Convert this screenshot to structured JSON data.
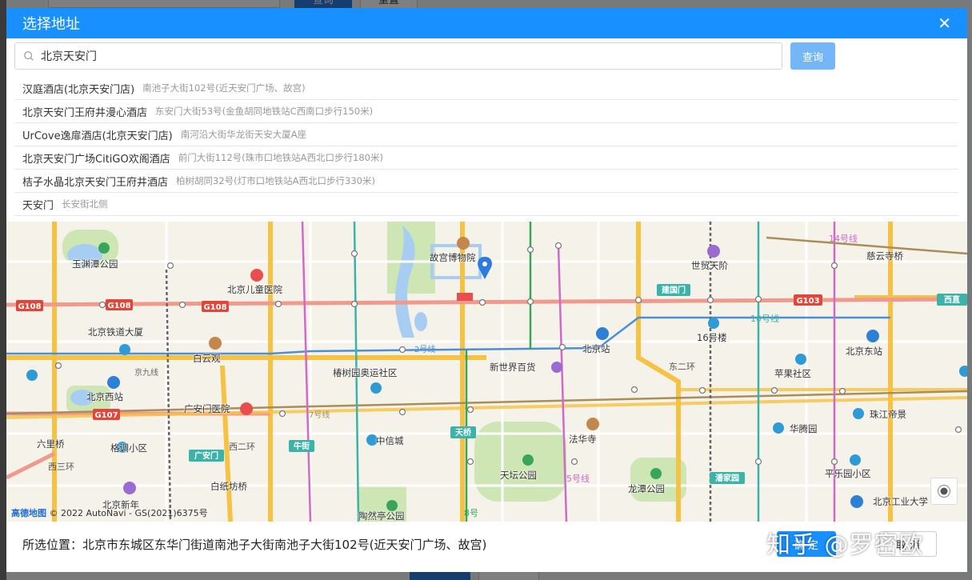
{
  "background": {
    "top_query_label": "查询",
    "top_reset_label": "重置"
  },
  "dialog": {
    "title": "选择地址",
    "close_icon": "close-icon"
  },
  "search": {
    "value": "北京天安门",
    "icon": "search-icon",
    "query_label": "查询"
  },
  "results": [
    {
      "name": "汉庭酒店(北京天安门店)",
      "address": "南池子大街102号(近天安门广场、故宫)"
    },
    {
      "name": "北京天安门王府井漫心酒店",
      "address": "东安门大街53号(金鱼胡同地铁站C西南口步行150米)"
    },
    {
      "name": "UrCove逸扉酒店(北京天安门店)",
      "address": "南河沿大街华龙街天安大厦A座"
    },
    {
      "name": "北京天安门广场CitiGO欢阁酒店",
      "address": "前门大街112号(珠市口地铁站A西北口步行180米)"
    },
    {
      "name": "桔子水晶北京天安门王府井酒店",
      "address": "柏树胡同32号(灯市口地铁站A西北口步行330米)"
    },
    {
      "name": "天安门",
      "address": "长安街北侧"
    }
  ],
  "map": {
    "labels": [
      {
        "text": "故宫博物院"
      },
      {
        "text": "玉渊潭公园"
      },
      {
        "text": "北京儿童医院"
      },
      {
        "text": "世贸天阶"
      },
      {
        "text": "慈云寺桥"
      },
      {
        "text": "建国门"
      },
      {
        "text": "北京铁道大厦"
      },
      {
        "text": "白云观"
      },
      {
        "text": "16号楼"
      },
      {
        "text": "北京站"
      },
      {
        "text": "北京东站"
      },
      {
        "text": "新世界百货"
      },
      {
        "text": "椿树园奥运社区"
      },
      {
        "text": "苹果社区"
      },
      {
        "text": "北京西站"
      },
      {
        "text": "广安门医院"
      },
      {
        "text": "华腾园"
      },
      {
        "text": "珠江帝景"
      },
      {
        "text": "法华寺"
      },
      {
        "text": "天桥"
      },
      {
        "text": "六里桥"
      },
      {
        "text": "格调小区"
      },
      {
        "text": "中信城"
      },
      {
        "text": "牛街"
      },
      {
        "text": "广安门"
      },
      {
        "text": "天坛公园"
      },
      {
        "text": "白纸坊桥"
      },
      {
        "text": "龙潭公园"
      },
      {
        "text": "潘家园"
      },
      {
        "text": "平乐园小区"
      },
      {
        "text": "北京新年"
      },
      {
        "text": "北京工业大学"
      },
      {
        "text": "2号线"
      },
      {
        "text": "7号线"
      },
      {
        "text": "京九线"
      },
      {
        "text": "G108"
      },
      {
        "text": "G107"
      },
      {
        "text": "G103"
      },
      {
        "text": "西直"
      },
      {
        "text": "东二环"
      },
      {
        "text": "西二环"
      },
      {
        "text": "10号线"
      },
      {
        "text": "14号线"
      },
      {
        "text": "5号线"
      },
      {
        "text": "8号"
      },
      {
        "text": "陶然亭公园"
      },
      {
        "text": "西三环"
      }
    ],
    "copyright": "高德地图 © 2022 AutoNavi - GS(2021)6375号",
    "copyright_logo": "高德地图",
    "copyright_rest": " © 2022 AutoNavi - GS(2021)6375号",
    "marker_icon": "map-pin-icon",
    "locate_icon": "locate-icon",
    "colors": {
      "land": "#f5f2ea",
      "park": "#cde6b4",
      "water": "#a7cdf2",
      "ring_road": "#f6c243",
      "national_road": "#f09a8e",
      "line_blue": "#4c8fd6",
      "line_green": "#3aa55a",
      "line_pink": "#d06ac8",
      "line_teal": "#3bb3a8"
    }
  },
  "footer": {
    "selected_prefix": "所选位置：",
    "selected_value": "北京市东城区东华门街道南池子大街南池子大街102号(近天安门广场、故宫)",
    "confirm_label": "确 定",
    "cancel_label": "取 消",
    "watermark": "知乎 @罗密欧"
  }
}
